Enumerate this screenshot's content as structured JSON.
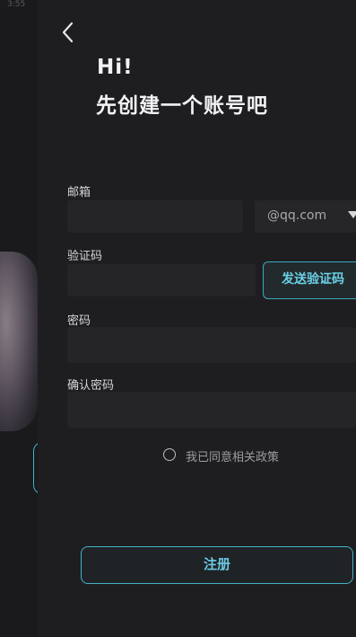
{
  "status_bar": {
    "time": "3:55",
    "icons": "▾ ▮"
  },
  "header": {
    "greeting": "Hi!",
    "headline": "先创建一个账号吧"
  },
  "form": {
    "email": {
      "label": "邮箱",
      "value": "",
      "placeholder": ""
    },
    "email_domain": {
      "selected": "@qq.com"
    },
    "code": {
      "label": "验证码",
      "value": "",
      "placeholder": ""
    },
    "send_code_label": "发送验证码",
    "password": {
      "label": "密码",
      "value": "",
      "placeholder": ""
    },
    "confirm_password": {
      "label": "确认密码",
      "value": "",
      "placeholder": ""
    },
    "agree_label": "我已同意相关政策",
    "agree_checked": false
  },
  "actions": {
    "register_label": "注册"
  },
  "icons": {
    "back": "chevron-left-icon",
    "dropdown": "caret-down-icon",
    "agree": "radio-icon"
  },
  "colors": {
    "accent": "#3bb6c8",
    "accent_text": "#6cc8e4",
    "background": "#1e1e20",
    "field": "#252527"
  }
}
